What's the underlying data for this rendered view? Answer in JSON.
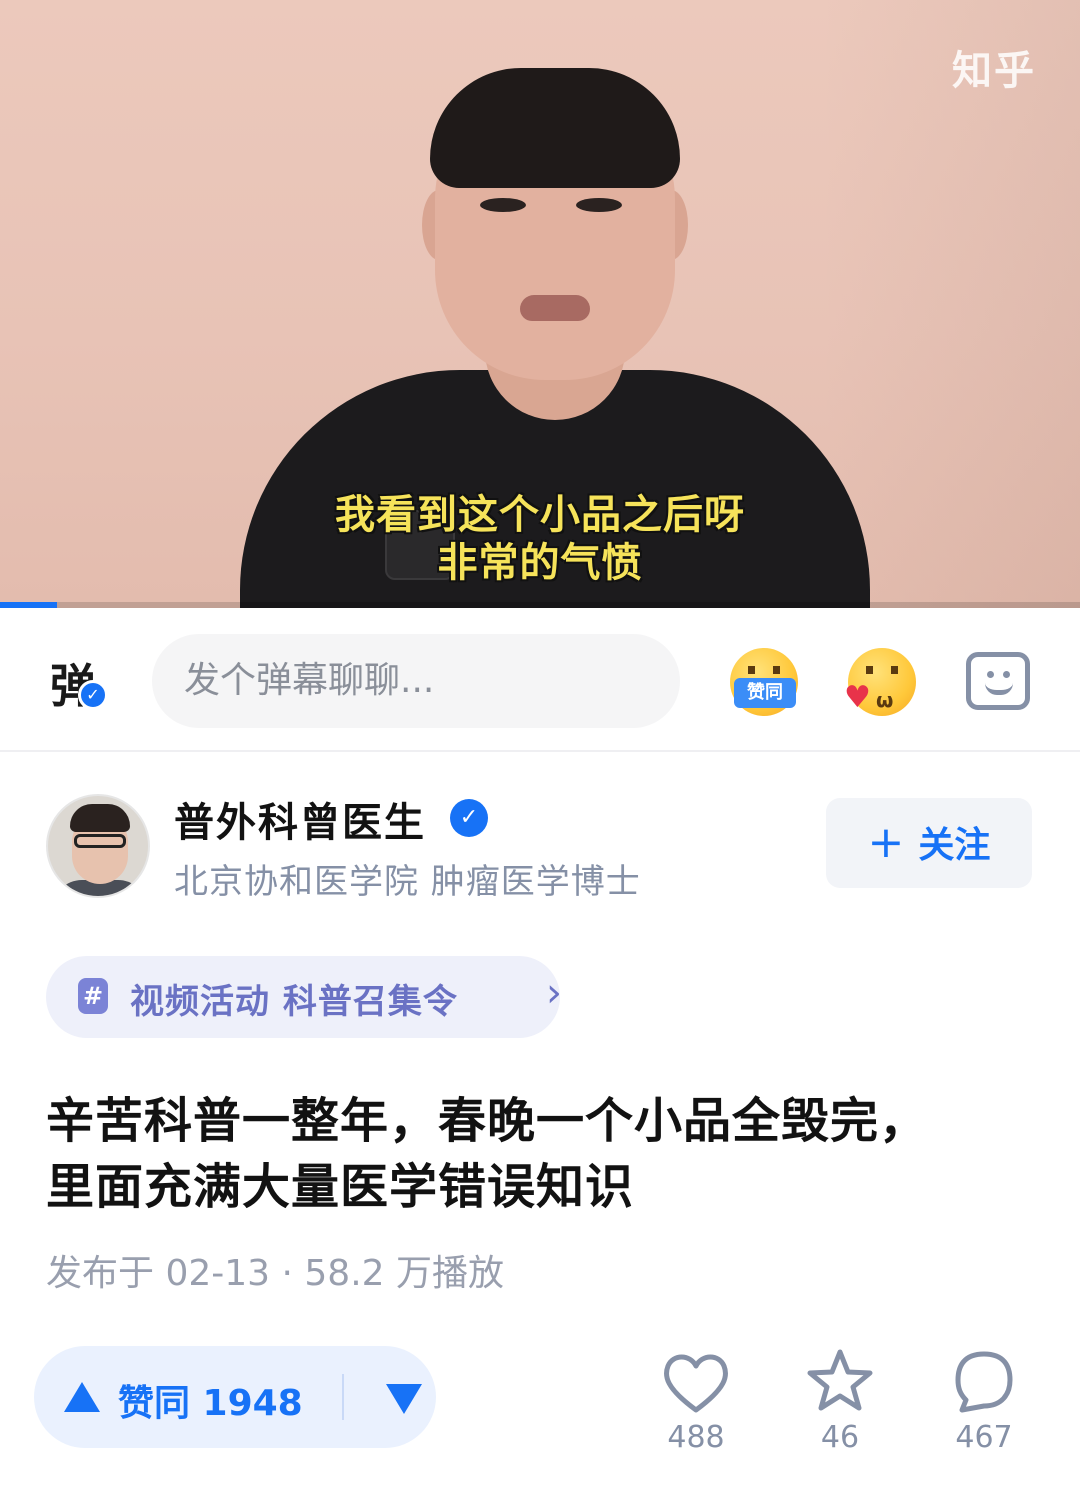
{
  "video": {
    "watermark": "知乎",
    "subtitle_line1": "我看到这个小品之后呀",
    "subtitle_line2": "非常的气愤",
    "progress_fraction": 0.053
  },
  "danmaku": {
    "toggle_glyph": "弹",
    "input_placeholder": "发个弹幕聊聊...",
    "agree_emoji_tag": "赞同"
  },
  "author": {
    "name": "普外科曾医生",
    "description": "北京协和医学院 肿瘤医学博士",
    "follow_label": "关注"
  },
  "topic": {
    "label": "视频活动 科普召集令"
  },
  "post": {
    "title_line1": "辛苦科普一整年，春晚一个小品全毁完，",
    "title_line2": "里面充满大量医学错误知识",
    "meta": "发布于 02-13 · 58.2 万播放"
  },
  "actions": {
    "vote_label": "赞同 1948",
    "like_count": "488",
    "favorite_count": "46",
    "comment_count": "467"
  },
  "colors": {
    "accent": "#1772f6",
    "subtitle": "#f6e35a",
    "muted": "#8590a6"
  }
}
